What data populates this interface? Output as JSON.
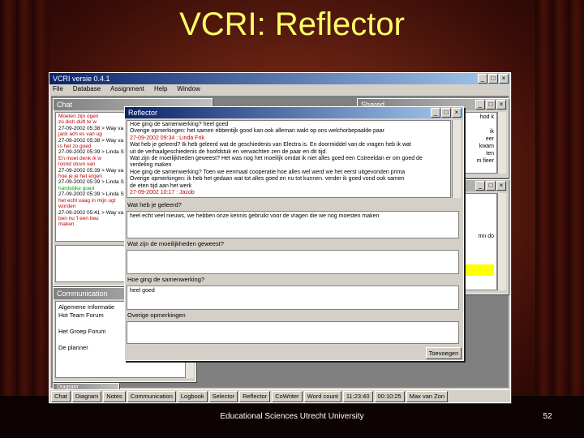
{
  "slide": {
    "title": "VCRI:  Reflector",
    "footer": "Educational Sciences Utrecht University",
    "page_number": "52"
  },
  "app": {
    "title": "VCRI versie 0.4.1",
    "menu": [
      "File",
      "Database",
      "Assignment",
      "Help",
      "Window"
    ],
    "chat_window": {
      "title": "Chat",
      "lines": [
        {
          "text": "Moeten zijn ogen",
          "color": "#c00000"
        },
        {
          "text": "zo dich duft te w",
          "color": "#c00000"
        },
        {
          "text": "27-09-2002 05:38 > Way va",
          "color": "#000000"
        },
        {
          "text": "jack ach es van ug",
          "color": "#c00000"
        },
        {
          "text": "27-09-2002 05:38 > Way va",
          "color": "#000000"
        },
        {
          "text": "is het zo goed",
          "color": "#c00000"
        },
        {
          "text": "27-09-2002 05:39 > Linda S",
          "color": "#000000"
        },
        {
          "text": "En moet denk ik w",
          "color": "#c00000"
        },
        {
          "text": "loond stuvo van",
          "color": "#c00000"
        },
        {
          "text": "27-09-2002 05:39 > Way va",
          "color": "#000000"
        },
        {
          "text": "hoe je je het ergen",
          "color": "#c00000"
        },
        {
          "text": "27-09-2002 05:39 > Linda S",
          "color": "#000000"
        },
        {
          "text": "hardstijke goed",
          "color": "#00a000"
        },
        {
          "text": "27-09-2002 05:39 > Linda S",
          "color": "#000000"
        },
        {
          "text": "het echt vaag in mijn ugt",
          "color": "#c00000"
        },
        {
          "text": "worden",
          "color": "#c00000"
        },
        {
          "text": "27-09-2002 05:41 > Way va",
          "color": "#000000"
        },
        {
          "text": "ben nu 'l een beu",
          "color": "#c00000"
        },
        {
          "text": "maken",
          "color": "#c00000"
        }
      ]
    },
    "comm_window": {
      "title": "Communication",
      "items": [
        "Algemene Informatie",
        "Hot Team Forum",
        "",
        "Het Groep Forum",
        "",
        "De planner"
      ]
    },
    "right_window": {
      "title": "Shared",
      "lines": [
        "hod k",
        "",
        "ik",
        "eer",
        "kwam",
        "ten",
        "m fieer"
      ],
      "lines2": [
        "mn do"
      ]
    },
    "diagram_tab": "Diagram",
    "taskbar": [
      "Chat",
      "Diagram",
      "Notes",
      "Communication",
      "Logbook",
      "Selector",
      "Reflector",
      "CoWriter",
      "Word count",
      "11:23:40",
      "00:10:25",
      "Max van Zon"
    ]
  },
  "reflector": {
    "title": "Reflector",
    "entries": [
      {
        "text": "Hoe ging de samenwerking? heel goed",
        "color": "#000000"
      },
      {
        "text": "Overige opmerkingen: het samen ebbentijk good kan ook alleman wakt op ons welchorbepaalde paar",
        "color": "#000000"
      },
      {
        "text": "27-09-2002 09:34 : Linda Frik",
        "color": "#c00000"
      },
      {
        "text": "Wat heb je geleerd? Ik heb geleerd wat de geschiedenis van Electra is. En doormiddel van de vragen heb ik wat",
        "color": "#000000"
      },
      {
        "text": "    uit de verhaalgeschiedenis de hoofdstuk en verwachten zen de paar en dit tijd.",
        "color": "#000000"
      },
      {
        "text": "Wat zijn de moeilijkheden geweest? Het was nog het moeilijk omdat ik niet alles goed een Cstreeldan er om goed de",
        "color": "#000000"
      },
      {
        "text": "    verdeling maken",
        "color": "#000000"
      },
      {
        "text": "Hoe ging de samenwerking? Toen we eenmaal cooperatie hoe alles wel werd we het eerst uitgevonden prima",
        "color": "#000000"
      },
      {
        "text": "Overige opmerkingen: ik heb het gedaan wat tot alles goed en nu tot kunnen. verder ik goed vond ook samen",
        "color": "#000000"
      },
      {
        "text": "    de eten tijd aan het werk",
        "color": "#000000"
      },
      {
        "text": "27-09-2002 10:17 : Jacob",
        "color": "#c00000"
      }
    ],
    "questions": [
      {
        "label": "Wat heb je geleerd?",
        "answer": "heel echt veel nieuws, we hebben onze kennis gebruikt voor de vragen die we nog moesten maken"
      },
      {
        "label": "Wat zijn de moeilijkheden geweest?",
        "answer": ""
      },
      {
        "label": "Hoe ging de samenwerking?",
        "answer": "heel goed"
      },
      {
        "label": "Overige opmerkingen",
        "answer": ""
      }
    ],
    "ok_label": "Toevoegen"
  }
}
